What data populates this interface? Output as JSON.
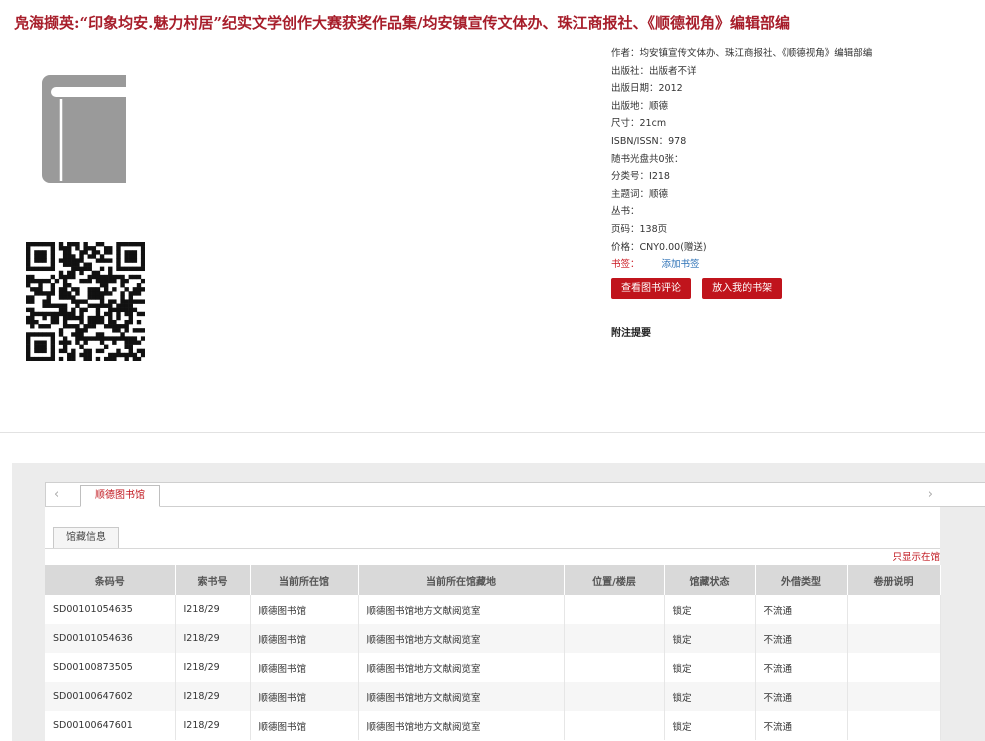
{
  "book": {
    "title": "凫海撷英:“印象均安.魅力村居”纪实文学创作大赛获奖作品集/均安镇宣传文体办、珠江商报社、《顺德视角》编辑部编",
    "cover_icon": "book-icon",
    "qr_icon": "qr-code-icon"
  },
  "meta": [
    {
      "label": "作者：",
      "value": "均安镇宣传文体办、珠江商报社、《顺德视角》编辑部编"
    },
    {
      "label": "出版社：",
      "value": "出版者不详"
    },
    {
      "label": "出版日期：",
      "value": "2012"
    },
    {
      "label": "出版地：",
      "value": "顺德"
    },
    {
      "label": "尺寸：",
      "value": "21cm"
    },
    {
      "label": "ISBN/ISSN：",
      "value": "978"
    },
    {
      "label": "随书光盘共0张：",
      "value": ""
    },
    {
      "label": "分类号：",
      "value": "I218"
    },
    {
      "label": "主题词：",
      "value": "顺德"
    },
    {
      "label": "丛书：",
      "value": ""
    },
    {
      "label": "页码：",
      "value": "138页"
    },
    {
      "label": "价格：",
      "value": "CNY0.00(赠送)"
    }
  ],
  "bookmark": {
    "label": "书签：",
    "add": "添加书签"
  },
  "buttons": {
    "review": "查看图书评论",
    "shelf": "放入我的书架"
  },
  "note_title": "附注提要",
  "holdings": {
    "tab_label": "顺德图书馆",
    "subtab_label": "馆藏信息",
    "only_show": "只显示在馆",
    "arrow_left": "‹",
    "arrow_right": "›",
    "columns": [
      "条码号",
      "索书号",
      "当前所在馆",
      "当前所在馆藏地",
      "位置/楼层",
      "馆藏状态",
      "外借类型",
      "卷册说明"
    ],
    "rows": [
      [
        "SD00101054635",
        "I218/29",
        "顺德图书馆",
        "顺德图书馆地方文献阅览室",
        "",
        "锁定",
        "不流通",
        ""
      ],
      [
        "SD00101054636",
        "I218/29",
        "顺德图书馆",
        "顺德图书馆地方文献阅览室",
        "",
        "锁定",
        "不流通",
        ""
      ],
      [
        "SD00100873505",
        "I218/29",
        "顺德图书馆",
        "顺德图书馆地方文献阅览室",
        "",
        "锁定",
        "不流通",
        ""
      ],
      [
        "SD00100647602",
        "I218/29",
        "顺德图书馆",
        "顺德图书馆地方文献阅览室",
        "",
        "锁定",
        "不流通",
        ""
      ],
      [
        "SD00100647601",
        "I218/29",
        "顺德图书馆",
        "顺德图书馆地方文献阅览室",
        "",
        "锁定",
        "不流通",
        ""
      ]
    ]
  },
  "colors": {
    "accent": "#c0141c",
    "title": "#a71d2a",
    "link": "#2a6fb5"
  }
}
